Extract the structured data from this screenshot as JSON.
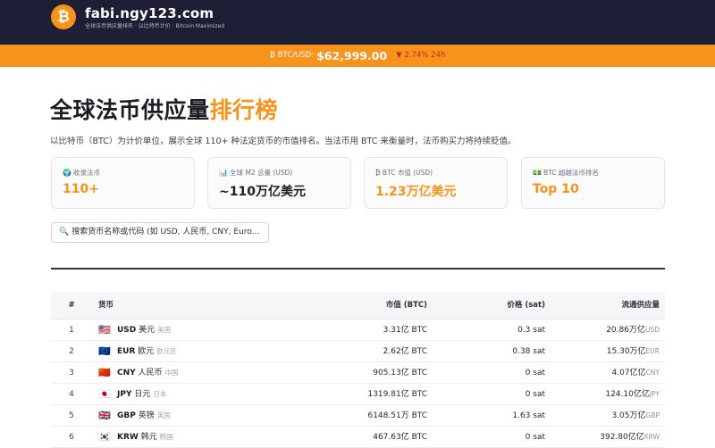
{
  "header": {
    "logo_glyph": "₿",
    "site_name": "fabi.ngy123.com",
    "subtitle": "全球法币供应量排名 · 以比特币计价 · Bitcoin Maximized"
  },
  "ticker": {
    "label": "₿ BTC/USD:",
    "price": "$62,999.00",
    "change": "▼ 2.74% 24h",
    "change_color": "#c62828"
  },
  "page": {
    "title_main": "全球法币供应量",
    "title_accent": "排行榜",
    "description": "以比特币（BTC）为计价单位，展示全球 110+ 种法定货币的市值排名。当法币用 BTC 来衡量时，法币购买力将持续贬值。"
  },
  "stats": [
    {
      "icon": "🌍",
      "icon_name": "globe-icon",
      "label": "收录法币",
      "value": "110+"
    },
    {
      "icon": "📊",
      "icon_name": "bar-chart-icon",
      "label": "全球 M2 总量 (USD)",
      "value": "~110万亿美元"
    },
    {
      "icon": "₿",
      "icon_name": "bitcoin-icon",
      "label": "BTC 市值 (USD)",
      "value": "1.23万亿美元"
    },
    {
      "icon": "💵",
      "icon_name": "banknote-icon",
      "label": "BTC 超越法币排名",
      "value": "Top 10"
    }
  ],
  "search": {
    "icon": "🔍",
    "placeholder": "搜索货币名称或代码 (如 USD, 人民币, CNY, Euro..."
  },
  "table": {
    "headers": {
      "rank": "#",
      "currency": "货币",
      "market_cap": "市值 (BTC)",
      "price": "价格 (sat)",
      "supply": "流通供应量"
    },
    "rows": [
      {
        "rank": "1",
        "flag": "🇺🇸",
        "code": "USD",
        "name": "美元",
        "region": "美国",
        "mcap": "3.31亿 BTC",
        "price": "0.3 sat",
        "supply": "20.86万亿",
        "supply_unit": "USD"
      },
      {
        "rank": "2",
        "flag": "🇪🇺",
        "code": "EUR",
        "name": "欧元",
        "region": "欧元区",
        "mcap": "2.62亿 BTC",
        "price": "0.38 sat",
        "supply": "15.30万亿",
        "supply_unit": "EUR"
      },
      {
        "rank": "3",
        "flag": "🇨🇳",
        "code": "CNY",
        "name": "人民币",
        "region": "中国",
        "mcap": "905.13亿 BTC",
        "price": "0 sat",
        "supply": "4.07亿亿",
        "supply_unit": "CNY"
      },
      {
        "rank": "4",
        "flag": "🇯🇵",
        "code": "JPY",
        "name": "日元",
        "region": "日本",
        "mcap": "1319.81亿 BTC",
        "price": "0 sat",
        "supply": "124.10亿亿",
        "supply_unit": "JPY"
      },
      {
        "rank": "5",
        "flag": "🇬🇧",
        "code": "GBP",
        "name": "英镑",
        "region": "英国",
        "mcap": "6148.51万 BTC",
        "price": "1.63 sat",
        "supply": "3.05万亿",
        "supply_unit": "GBP"
      },
      {
        "rank": "6",
        "flag": "🇰🇷",
        "code": "KRW",
        "name": "韩元",
        "region": "韩国",
        "mcap": "467.63亿 BTC",
        "price": "0 sat",
        "supply": "392.80亿亿",
        "supply_unit": "KRW"
      }
    ]
  }
}
